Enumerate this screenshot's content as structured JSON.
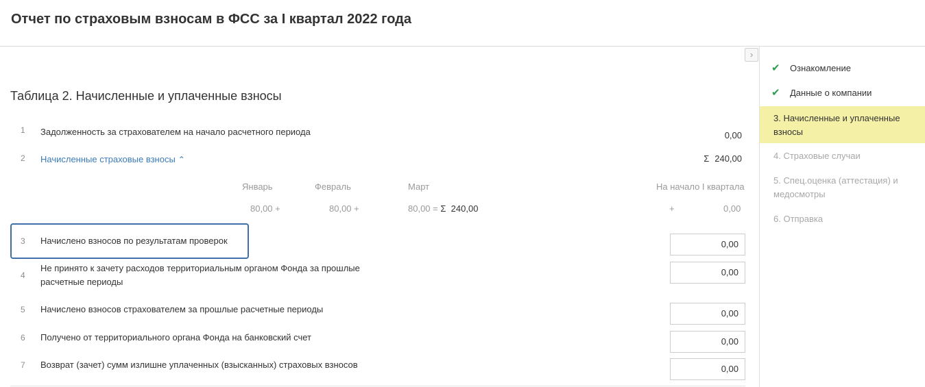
{
  "page": {
    "title": "Отчет по страховым взносам в ФСС за I квартал 2022 года"
  },
  "sidebar_toggle": {
    "icon": "chevron-right-icon",
    "glyph": "›"
  },
  "section": {
    "title": "Таблица 2. Начисленные и уплаченные взносы"
  },
  "rows": {
    "r1": {
      "num": "1",
      "label": "Задолженность за страхователем на начало расчетного периода",
      "value": "0,00"
    },
    "r2": {
      "num": "2",
      "label": "Начисленные страховые взносы",
      "chevron": "^",
      "sigma": "Σ",
      "value": "240,00"
    },
    "r3": {
      "num": "3",
      "label": "Начислено взносов по результатам проверок",
      "value": "0,00"
    },
    "r4": {
      "num": "4",
      "label": "Не принято к зачету расходов территориальным органом Фонда за прошлые расчетные периоды",
      "value": "0,00"
    },
    "r5": {
      "num": "5",
      "label": "Начислено взносов страхователем за прошлые расчетные периоды",
      "value": "0,00"
    },
    "r6": {
      "num": "6",
      "label": "Получено от территориального органа Фонда на банковский счет",
      "value": "0,00"
    },
    "r7": {
      "num": "7",
      "label": "Возврат (зачет) сумм излишне уплаченных (взысканных) страховых взносов",
      "value": "0,00"
    }
  },
  "breakdown": {
    "headers": {
      "jan": "Январь",
      "feb": "Февраль",
      "mar": "Март",
      "start": "На начало I квартала"
    },
    "values": {
      "jan": "80,00 +",
      "feb": "80,00 +",
      "mar": "80,00 =",
      "sigma": "Σ",
      "total": "240,00",
      "plus": "+",
      "start": "0,00"
    }
  },
  "sidebar": {
    "steps": [
      {
        "label": "Ознакомление",
        "state": "done",
        "icon": "check-icon"
      },
      {
        "label": "Данные о компании",
        "state": "done",
        "icon": "check-icon"
      },
      {
        "label": "3.  Начисленные и уплаченные взносы",
        "state": "active"
      },
      {
        "label": "4.  Страховые случаи",
        "state": "pending"
      },
      {
        "label": "5.  Спец.оценка (аттестация) и медосмотры",
        "state": "pending"
      },
      {
        "label": "6.  Отправка",
        "state": "pending"
      }
    ]
  },
  "colors": {
    "link": "#3b7bb8",
    "check": "#2e9e4e",
    "active_step_bg": "#f4f0a6",
    "focus_border": "#3e6fa8"
  }
}
